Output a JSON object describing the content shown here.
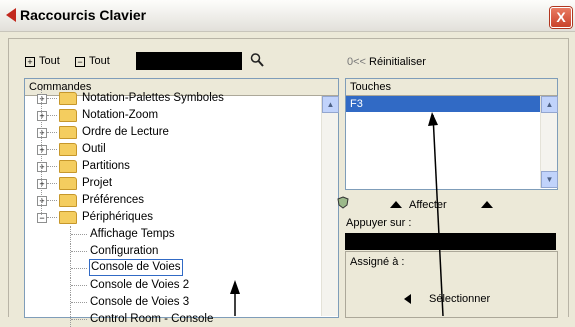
{
  "window": {
    "title": "Raccourcis Clavier",
    "close_glyph": "X"
  },
  "toolbar": {
    "expand_all_label": "Tout",
    "collapse_all_label": "Tout",
    "search_value": "",
    "reset_label": "Réinitialiser",
    "reset_prefix": "0<<"
  },
  "commands": {
    "header": "Commandes",
    "items": [
      {
        "label": "Notation-Palettes Symboles",
        "type": "folder"
      },
      {
        "label": "Notation-Zoom",
        "type": "folder"
      },
      {
        "label": "Ordre de Lecture",
        "type": "folder"
      },
      {
        "label": "Outil",
        "type": "folder"
      },
      {
        "label": "Partitions",
        "type": "folder"
      },
      {
        "label": "Projet",
        "type": "folder"
      },
      {
        "label": "Préférences",
        "type": "folder"
      },
      {
        "label": "Périphériques",
        "type": "folder-open"
      },
      {
        "label": "Affichage Temps",
        "type": "leaf"
      },
      {
        "label": "Configuration",
        "type": "leaf"
      },
      {
        "label": "Console de Voies",
        "type": "leaf-selected"
      },
      {
        "label": "Console de Voies 2",
        "type": "leaf"
      },
      {
        "label": "Console de Voies 3",
        "type": "leaf"
      },
      {
        "label": "Control Room - Console",
        "type": "leaf"
      }
    ]
  },
  "keys": {
    "header": "Touches",
    "items": [
      "F3"
    ]
  },
  "assign": {
    "label": "Affecter"
  },
  "press_on": {
    "label": "Appuyer sur :"
  },
  "assigned_to": {
    "label": "Assigné à :"
  },
  "select": {
    "label": "Sélectionner"
  },
  "colors": {
    "accent_blue": "#316ac5",
    "title_icon": "#c2281d"
  }
}
